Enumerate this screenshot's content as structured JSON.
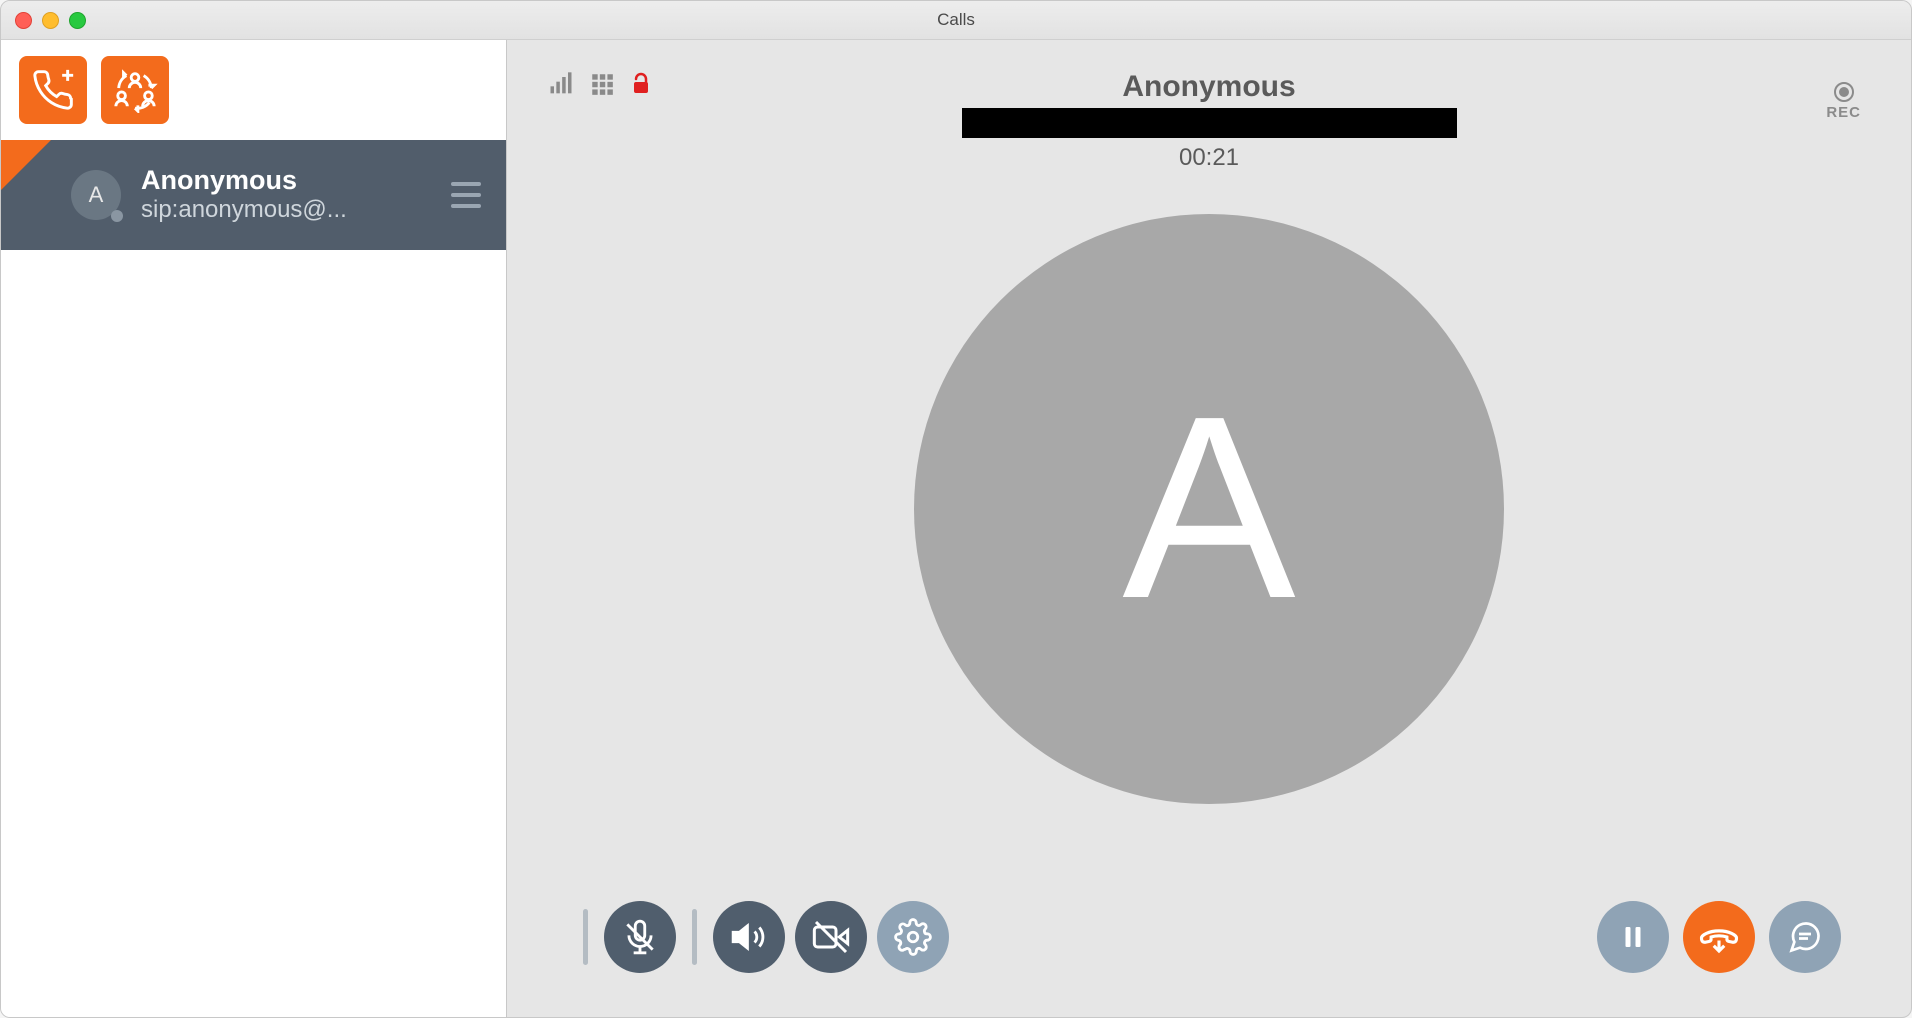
{
  "window": {
    "title": "Calls"
  },
  "sidebar": {
    "call_item": {
      "avatar_initial": "A",
      "name": "Anonymous",
      "uri": "sip:anonymous@..."
    }
  },
  "call": {
    "name": "Anonymous",
    "duration": "00:21",
    "avatar_initial": "A",
    "rec_label": "REC"
  }
}
